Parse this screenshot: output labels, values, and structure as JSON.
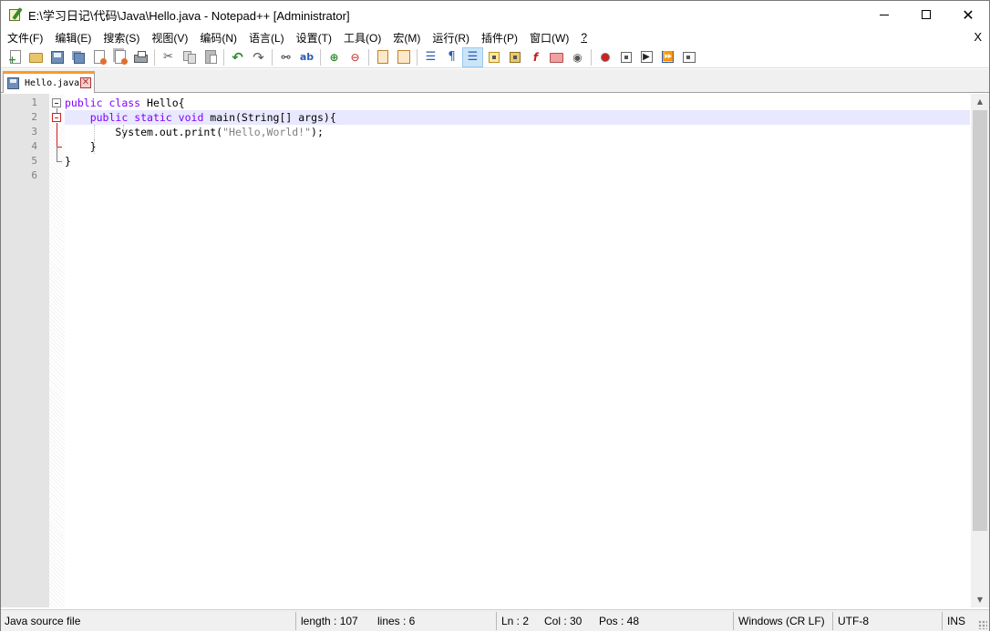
{
  "window": {
    "title": "E:\\学习日记\\代码\\Java\\Hello.java - Notepad++ [Administrator]",
    "minimize_label": "",
    "maximize_label": "",
    "close_label": "✕"
  },
  "menu": {
    "items": [
      "文件(F)",
      "编辑(E)",
      "搜索(S)",
      "视图(V)",
      "编码(N)",
      "语言(L)",
      "设置(T)",
      "工具(O)",
      "宏(M)",
      "运行(R)",
      "插件(P)",
      "窗口(W)",
      "?"
    ],
    "close_doc": "X"
  },
  "toolbar": {
    "icons": [
      "new-file-icon",
      "open-file-icon",
      "save-icon",
      "save-all-icon",
      "close-icon",
      "close-all-icon",
      "print-icon",
      "cut-icon",
      "copy-icon",
      "paste-icon",
      "undo-icon",
      "redo-icon",
      "find-icon",
      "replace-icon",
      "zoom-in-icon",
      "zoom-out-icon",
      "sync-vertical-icon",
      "sync-horizontal-icon",
      "word-wrap-icon",
      "show-all-chars-icon",
      "indent-guide-icon",
      "user-language-icon",
      "document-map-icon",
      "function-list-icon",
      "folder-as-workspace-icon",
      "monitoring-icon",
      "record-macro-icon",
      "stop-recording-icon",
      "playback-macro-icon",
      "run-macro-multiple-icon",
      "save-macro-icon"
    ],
    "active_icon": "indent-guide-icon"
  },
  "tabs": [
    {
      "label": "Hello.java",
      "close": "✕",
      "active": true
    }
  ],
  "editor": {
    "lines": [
      {
        "num": "1",
        "tokens": [
          {
            "t": "public",
            "c": "kw"
          },
          {
            "t": " ",
            "c": ""
          },
          {
            "t": "class",
            "c": "kw"
          },
          {
            "t": " Hello{",
            "c": ""
          }
        ]
      },
      {
        "num": "2",
        "current": true,
        "tokens": [
          {
            "t": "    ",
            "c": ""
          },
          {
            "t": "public",
            "c": "kw"
          },
          {
            "t": " ",
            "c": ""
          },
          {
            "t": "static",
            "c": "kw"
          },
          {
            "t": " ",
            "c": ""
          },
          {
            "t": "void",
            "c": "kw"
          },
          {
            "t": " main(String[] args){",
            "c": ""
          }
        ]
      },
      {
        "num": "3",
        "tokens": [
          {
            "t": "        System.out.print(",
            "c": ""
          },
          {
            "t": "\"Hello,World!\"",
            "c": "str"
          },
          {
            "t": ");",
            "c": ""
          }
        ]
      },
      {
        "num": "4",
        "tokens": [
          {
            "t": "    }",
            "c": ""
          }
        ]
      },
      {
        "num": "5",
        "tokens": [
          {
            "t": "}",
            "c": ""
          }
        ]
      },
      {
        "num": "6",
        "tokens": []
      }
    ]
  },
  "statusbar": {
    "language": "Java source file",
    "length": "length : 107",
    "lines": "lines : 6",
    "ln": "Ln : 2",
    "col": "Col : 30",
    "pos": "Pos : 48",
    "eol": "Windows (CR LF)",
    "encoding": "UTF-8",
    "mode": "INS"
  }
}
